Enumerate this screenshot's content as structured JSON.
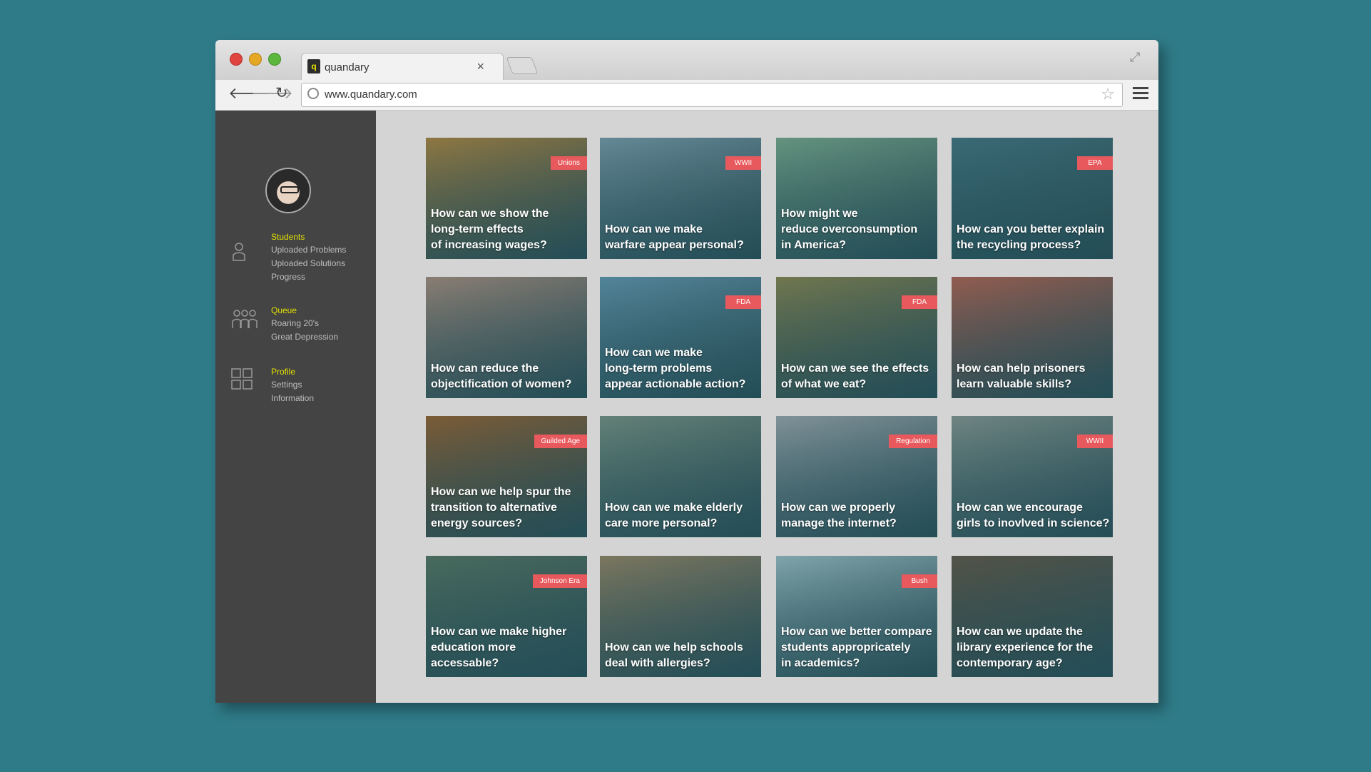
{
  "browser": {
    "tab_title": "quandary",
    "tab_favicon": "q",
    "tab_close": "×",
    "url": "www.quandary.com"
  },
  "sidebar": {
    "sections": [
      {
        "heading": "Students",
        "items": [
          "Uploaded Problems",
          "Uploaded Solutions",
          "Progress"
        ],
        "icon": "person-icon"
      },
      {
        "heading": "Queue",
        "items": [
          "Roaring 20's",
          "Great Depression"
        ],
        "icon": "group-icon"
      },
      {
        "heading": "Profile",
        "items": [
          "Settings",
          "Information"
        ],
        "icon": "grid-icon"
      }
    ]
  },
  "colors": {
    "accent_yellow": "#e3e000",
    "tag_red": "#e8595d",
    "sidebar_bg": "#444444",
    "page_bg": "#2f7b88"
  },
  "cards": [
    {
      "tag": "Unions",
      "caption": "How can we show the\nlong-term effects\nof increasing wages?",
      "bg": "#a07a3a"
    },
    {
      "tag": "WWII",
      "caption": "How can we make\nwarfare appear personal?",
      "bg": "#6f8f9c"
    },
    {
      "tag": "",
      "caption": "How might we\nreduce overconsumption\nin America?",
      "bg": "#6f9c82"
    },
    {
      "tag": "EPA",
      "caption": "How can you better explain\nthe recycling process?",
      "bg": "#3d6b76"
    },
    {
      "tag": "",
      "caption": "How can reduce the\nobjectification of women?",
      "bg": "#9b8274"
    },
    {
      "tag": "FDA",
      "caption": "How can we make\nlong-term problems\nappear actionable action?",
      "bg": "#5a8ba1"
    },
    {
      "tag": "FDA",
      "caption": "How can we see the effects\nof what we eat?",
      "bg": "#7d7a49"
    },
    {
      "tag": "",
      "caption": "How can help prisoners\nlearn valuable skills?",
      "bg": "#a55b4a"
    },
    {
      "tag": "Guilded Age",
      "caption": "How can we help spur the\ntransition to alternative\nenergy sources?",
      "bg": "#8a5a2c"
    },
    {
      "tag": "",
      "caption": "How can we make elderly\ncare more personal?",
      "bg": "#6e8679"
    },
    {
      "tag": "Regulation",
      "caption": "How can we properly\nmanage the internet?",
      "bg": "#8f9aa0"
    },
    {
      "tag": "WWII",
      "caption": "How can we encourage\ngirls to inovlved in science?",
      "bg": "#7b8b86"
    },
    {
      "tag": "Johnson Era",
      "caption": "How can we make higher\neducation more accessable?",
      "bg": "#4f6c5a"
    },
    {
      "tag": "",
      "caption": "How can we help schools\ndeal with allergies?",
      "bg": "#8a7a5c"
    },
    {
      "tag": "Bush",
      "caption": "How can we better compare\nstudents appropricately\nin academics?",
      "bg": "#8fb0b6"
    },
    {
      "tag": "",
      "caption": "How can we update the\nlibrary experience for the\ncontemporary age?",
      "bg": "#5a5040"
    }
  ]
}
